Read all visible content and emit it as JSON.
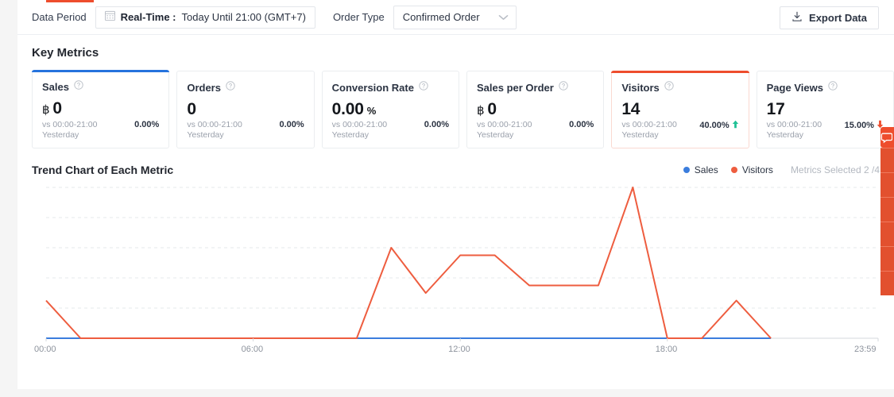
{
  "topbar": {
    "data_period_label": "Data Period",
    "calendar_icon": "calendar-icon",
    "realtime_prefix": "Real-Time :",
    "realtime_value": "Today Until 21:00 (GMT+7)",
    "order_type_label": "Order Type",
    "order_type_value": "Confirmed Order",
    "chevron_icon": "chevron-down-icon",
    "export_label": "Export Data",
    "export_icon": "download-icon",
    "accent_color": "#ee4d2d"
  },
  "key_metrics": {
    "title": "Key Metrics",
    "cards": [
      {
        "name": "Sales",
        "currency": "฿",
        "value": "0",
        "suffix": "",
        "compare_line1": "vs 00:00-21:00",
        "compare_line2": "Yesterday",
        "delta": "0.00%",
        "trend": "none",
        "selected": "blue"
      },
      {
        "name": "Orders",
        "currency": "",
        "value": "0",
        "suffix": "",
        "compare_line1": "vs 00:00-21:00",
        "compare_line2": "Yesterday",
        "delta": "0.00%",
        "trend": "none",
        "selected": "none"
      },
      {
        "name": "Conversion Rate",
        "currency": "",
        "value": "0.00",
        "suffix": "%",
        "compare_line1": "vs 00:00-21:00",
        "compare_line2": "Yesterday",
        "delta": "0.00%",
        "trend": "none",
        "selected": "none"
      },
      {
        "name": "Sales per Order",
        "currency": "฿",
        "value": "0",
        "suffix": "",
        "compare_line1": "vs 00:00-21:00",
        "compare_line2": "Yesterday",
        "delta": "0.00%",
        "trend": "none",
        "selected": "none"
      },
      {
        "name": "Visitors",
        "currency": "",
        "value": "14",
        "suffix": "",
        "compare_line1": "vs 00:00-21:00",
        "compare_line2": "Yesterday",
        "delta": "40.00%",
        "trend": "up",
        "selected": "orange"
      },
      {
        "name": "Page Views",
        "currency": "",
        "value": "17",
        "suffix": "",
        "compare_line1": "vs 00:00-21:00",
        "compare_line2": "Yesterday",
        "delta": "15.00%",
        "trend": "down",
        "selected": "none"
      }
    ],
    "help_icon": "question-circle-icon",
    "up_color": "#21c196",
    "down_color": "#ee4d2d"
  },
  "trend": {
    "title": "Trend Chart of Each Metric",
    "legend": [
      {
        "label": "Sales",
        "color": "#3b7ddd"
      },
      {
        "label": "Visitors",
        "color": "#ee5d3f"
      }
    ],
    "metrics_selected": "Metrics Selected 2 /4"
  },
  "chart_data": {
    "type": "line",
    "title": "Trend Chart of Each Metric",
    "xlabel": "",
    "ylabel": "",
    "grid": true,
    "legend_position": "top-right",
    "xticks": [
      "00:00",
      "06:00",
      "12:00",
      "18:00",
      "23:59"
    ],
    "x": [
      "00:00",
      "01:00",
      "02:00",
      "03:00",
      "04:00",
      "05:00",
      "06:00",
      "07:00",
      "08:00",
      "09:00",
      "10:00",
      "11:00",
      "12:00",
      "13:00",
      "14:00",
      "15:00",
      "16:00",
      "17:00",
      "18:00",
      "19:00",
      "20:00",
      "21:00"
    ],
    "ylim": [
      0,
      4
    ],
    "series": [
      {
        "name": "Sales",
        "color": "#3b7ddd",
        "values": [
          0,
          0,
          0,
          0,
          0,
          0,
          0,
          0,
          0,
          0,
          0,
          0,
          0,
          0,
          0,
          0,
          0,
          0,
          0,
          0,
          0,
          0
        ]
      },
      {
        "name": "Visitors",
        "color": "#ee5d3f",
        "values": [
          1,
          0,
          0,
          0,
          0,
          0,
          0,
          0,
          0,
          0,
          2.4,
          1.2,
          2.2,
          2.2,
          1.4,
          1.4,
          1.4,
          4,
          0,
          0,
          1,
          0
        ]
      }
    ]
  },
  "side_widget": {
    "chat_icon": "chat-bubble-icon",
    "color": "#ee4d2d",
    "items": 6
  }
}
